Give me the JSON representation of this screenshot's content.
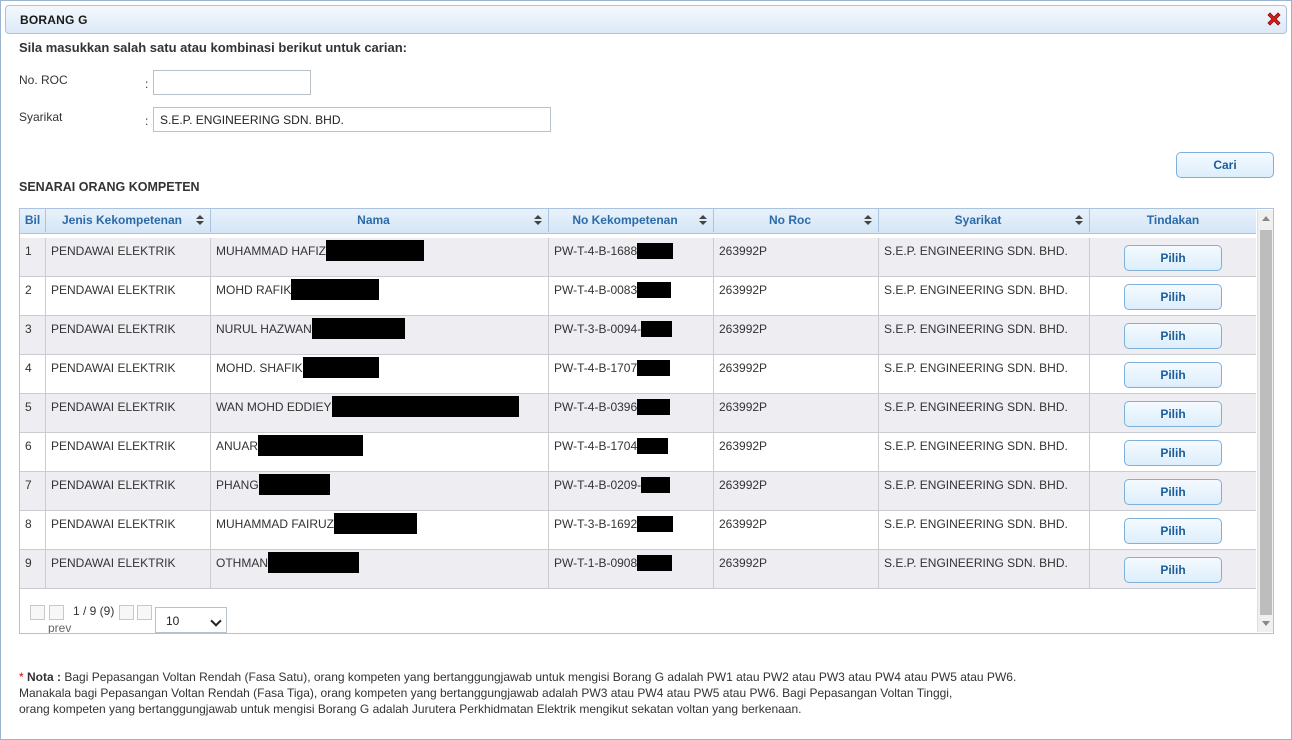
{
  "dialog": {
    "title": "BORANG G",
    "close_icon": "close-icon"
  },
  "form": {
    "instruction": "Sila masukkan salah satu atau kombinasi berikut untuk carian:",
    "roc_label": "No. ROC",
    "roc_value": "",
    "syarikat_label": "Syarikat",
    "syarikat_value": "S.E.P. ENGINEERING SDN. BHD.",
    "colon": ":",
    "search_button": "Cari"
  },
  "list": {
    "title": "SENARAI ORANG KOMPETEN",
    "columns": [
      "Bil",
      "Jenis Kekompetenan",
      "Nama",
      "No Kekompetenan",
      "No Roc",
      "Syarikat",
      "Tindakan"
    ],
    "action_label": "Pilih",
    "rows": [
      {
        "bil": "1",
        "jenis": "PENDAWAI ELEKTRIK",
        "nama": "MUHAMMAD HAFIZ",
        "no": "PW-T-4-B-1688",
        "roc": "263992P",
        "syarikat": "S.E.P. ENGINEERING SDN. BHD."
      },
      {
        "bil": "2",
        "jenis": "PENDAWAI ELEKTRIK",
        "nama": "MOHD RAFIK",
        "no": "PW-T-4-B-0083",
        "roc": "263992P",
        "syarikat": "S.E.P. ENGINEERING SDN. BHD."
      },
      {
        "bil": "3",
        "jenis": "PENDAWAI ELEKTRIK",
        "nama": "NURUL HAZWAN",
        "no": "PW-T-3-B-0094-",
        "roc": "263992P",
        "syarikat": "S.E.P. ENGINEERING SDN. BHD."
      },
      {
        "bil": "4",
        "jenis": "PENDAWAI ELEKTRIK",
        "nama": "MOHD. SHAFIK",
        "no": "PW-T-4-B-1707",
        "roc": "263992P",
        "syarikat": "S.E.P. ENGINEERING SDN. BHD."
      },
      {
        "bil": "5",
        "jenis": "PENDAWAI ELEKTRIK",
        "nama": "WAN MOHD EDDIEY",
        "no": "PW-T-4-B-0396",
        "roc": "263992P",
        "syarikat": "S.E.P. ENGINEERING SDN. BHD."
      },
      {
        "bil": "6",
        "jenis": "PENDAWAI ELEKTRIK",
        "nama": "ANUAR",
        "no": "PW-T-4-B-1704",
        "roc": "263992P",
        "syarikat": "S.E.P. ENGINEERING SDN. BHD."
      },
      {
        "bil": "7",
        "jenis": "PENDAWAI ELEKTRIK",
        "nama": "PHANG",
        "no": "PW-T-4-B-0209-",
        "roc": "263992P",
        "syarikat": "S.E.P. ENGINEERING SDN. BHD."
      },
      {
        "bil": "8",
        "jenis": "PENDAWAI ELEKTRIK",
        "nama": "MUHAMMAD FAIRUZ",
        "no": "PW-T-3-B-1692",
        "roc": "263992P",
        "syarikat": "S.E.P. ENGINEERING SDN. BHD."
      },
      {
        "bil": "9",
        "jenis": "PENDAWAI ELEKTRIK",
        "nama": "OTHMAN",
        "no": "PW-T-1-B-0908",
        "roc": "263992P",
        "syarikat": "S.E.P. ENGINEERING SDN. BHD."
      }
    ]
  },
  "pager": {
    "prev_label": "prev",
    "page_info": "1 / 9 (9)",
    "page_size": "10"
  },
  "note": {
    "star": "*",
    "label": "Nota :",
    "line1": "Bagi Pepasangan Voltan Rendah (Fasa Satu), orang kompeten yang bertanggungjawab untuk mengisi Borang G adalah PW1 atau PW2 atau PW3 atau PW4 atau PW5 atau PW6.",
    "line2": "Manakala bagi Pepasangan Voltan Rendah (Fasa Tiga), orang kompeten yang bertanggungjawab adalah PW3 atau PW4 atau PW5 atau PW6. Bagi Pepasangan Voltan Tinggi,",
    "line3": "orang kompeten yang bertanggungjawab untuk mengisi Borang G adalah Jurutera Perkhidmatan Elektrik mengikut sekatan voltan yang berkenaan."
  }
}
